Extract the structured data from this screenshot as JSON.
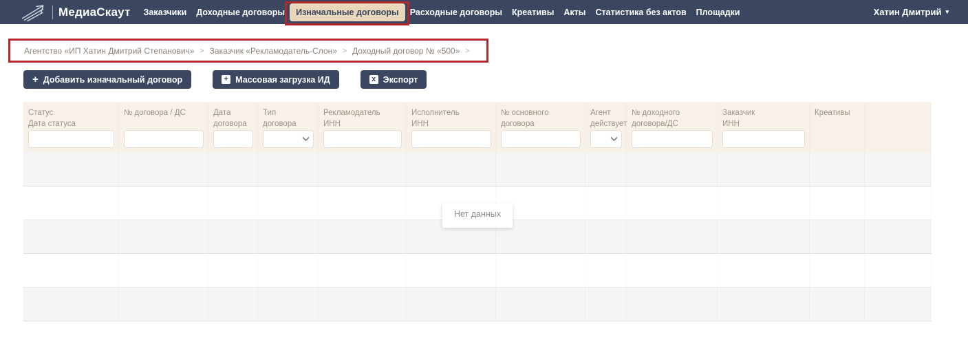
{
  "app": {
    "logo_text": "МедиаСкаут",
    "user_name": "Хатин Дмитрий"
  },
  "nav": {
    "items": [
      {
        "label": "Заказчики",
        "active": false
      },
      {
        "label": "Доходные договоры",
        "active": false
      },
      {
        "label": "Изначальные договоры",
        "active": true
      },
      {
        "label": "Расходные договоры",
        "active": false
      },
      {
        "label": "Креативы",
        "active": false
      },
      {
        "label": "Акты",
        "active": false
      },
      {
        "label": "Статистика без актов",
        "active": false
      },
      {
        "label": "Площадки",
        "active": false
      }
    ]
  },
  "breadcrumb": {
    "separator": ">",
    "items": [
      "Агентство «ИП Хатин Дмитрий Степанович»",
      "Заказчик «Рекламодатель-Слон»",
      "Доходный договор № «500»"
    ]
  },
  "toolbar": {
    "add_button": "Добавить изначальный договор",
    "bulk_button": "Массовая загрузка ИД",
    "export_button": "Экспорт"
  },
  "table": {
    "empty_message": "Нет данных",
    "row_count": 5,
    "columns": [
      {
        "key": "status",
        "lines": [
          "Статус",
          "Дата статуса"
        ],
        "filter": "text"
      },
      {
        "key": "contract-number",
        "lines": [
          "№ договора / ДС"
        ],
        "filter": "text"
      },
      {
        "key": "contract-date",
        "lines": [
          "Дата",
          "договора"
        ],
        "filter": "text"
      },
      {
        "key": "contract-type",
        "lines": [
          "Тип",
          "договора"
        ],
        "filter": "select"
      },
      {
        "key": "advertiser",
        "lines": [
          "Рекламодатель",
          "ИНН"
        ],
        "filter": "text"
      },
      {
        "key": "executor",
        "lines": [
          "Исполнитель",
          "ИНН"
        ],
        "filter": "text"
      },
      {
        "key": "main-contract-number",
        "lines": [
          "№ основного",
          "договора"
        ],
        "filter": "text"
      },
      {
        "key": "agent-acting",
        "lines": [
          "Агент",
          "действует"
        ],
        "filter": "select"
      },
      {
        "key": "income-contract-number",
        "lines": [
          "№ доходного",
          "договора/ДС"
        ],
        "filter": "text"
      },
      {
        "key": "customer",
        "lines": [
          "Заказчик",
          "ИНН"
        ],
        "filter": "text"
      },
      {
        "key": "creatives",
        "lines": [
          "Креативы"
        ],
        "filter": "none"
      },
      {
        "key": "actions",
        "lines": [],
        "filter": "none"
      }
    ]
  },
  "colors": {
    "navbar_bg": "#3b4761",
    "active_tab_bg": "#e8d7ba",
    "annotation_red": "#b3282a",
    "table_header_bg": "#f8f1e9",
    "header_text": "#9d9488",
    "breadcrumb_text": "#8c8279",
    "row_alt_bg": "#f5f5f5",
    "empty_text": "#8d8d8d"
  }
}
